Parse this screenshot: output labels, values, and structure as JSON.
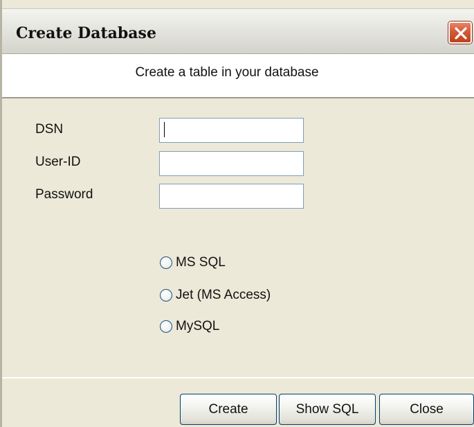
{
  "window": {
    "title": "Create Database",
    "close_icon": "close-icon",
    "header_text": "Create a table in your database"
  },
  "form": {
    "fields": [
      {
        "label": "DSN",
        "value": ""
      },
      {
        "label": "User-ID",
        "value": ""
      },
      {
        "label": "Password",
        "value": ""
      }
    ],
    "db_options": [
      {
        "label": "MS SQL",
        "selected": false
      },
      {
        "label": "Jet (MS Access)",
        "selected": false
      },
      {
        "label": "MySQL",
        "selected": false
      }
    ]
  },
  "buttons": {
    "create": "Create",
    "show_sql": "Show SQL",
    "close": "Close"
  },
  "colors": {
    "dialog_bg": "#ece9d8",
    "close_button": "#d35a36",
    "input_border": "#7f9db9",
    "button_border": "#003c74"
  }
}
